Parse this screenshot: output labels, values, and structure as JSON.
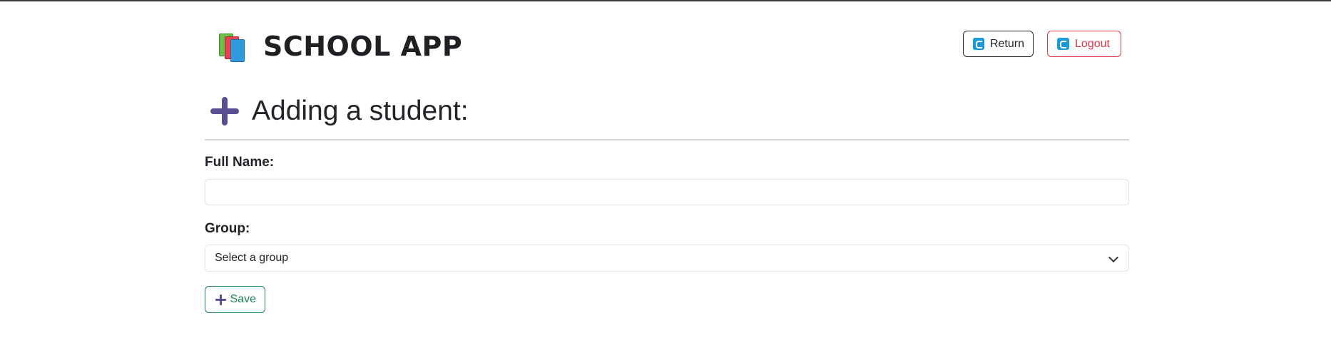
{
  "app": {
    "title": "SCHOOL APP",
    "logo_icon": "books-icon"
  },
  "header": {
    "return_label": "Return",
    "return_icon": "return-icon",
    "logout_label": "Logout",
    "logout_icon": "logout-icon"
  },
  "page": {
    "heading": "Adding a student:",
    "heading_icon": "plus-icon"
  },
  "form": {
    "full_name_label": "Full Name:",
    "full_name_value": "",
    "group_label": "Group:",
    "group_selected": "Select a group",
    "save_label": "Save"
  },
  "colors": {
    "accent_purple": "#5b4f93",
    "save_green": "#198754",
    "logout_red": "#dc3545",
    "icon_blue": "#1a9ad6"
  }
}
